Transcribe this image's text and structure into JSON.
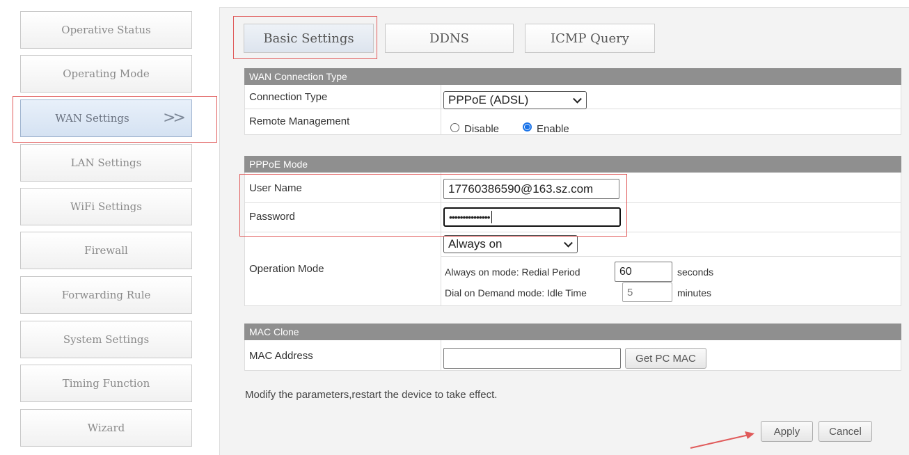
{
  "sidebar": {
    "items": [
      {
        "label": "Operative Status"
      },
      {
        "label": "Operating Mode"
      },
      {
        "label": "WAN Settings",
        "arrows": ">>"
      },
      {
        "label": "LAN Settings"
      },
      {
        "label": "WiFi Settings"
      },
      {
        "label": "Firewall"
      },
      {
        "label": "Forwarding Rule"
      },
      {
        "label": "System Settings"
      },
      {
        "label": "Timing Function"
      },
      {
        "label": "Wizard"
      }
    ],
    "active_index": 2
  },
  "tabs": [
    {
      "label": "Basic Settings"
    },
    {
      "label": "DDNS"
    },
    {
      "label": "ICMP Query"
    }
  ],
  "wan_type": {
    "title": "WAN Connection Type",
    "connection_type_label": "Connection Type",
    "connection_type_value": "PPPoE (ADSL)",
    "remote_mgmt_label": "Remote Management",
    "disable_label": "Disable",
    "enable_label": "Enable",
    "remote_mgmt_selected": "Enable"
  },
  "pppoe": {
    "title": "PPPoE Mode",
    "username_label": "User Name",
    "username_value": "17760386590@163.sz.com",
    "password_label": "Password",
    "password_value": "•••••••••••••••",
    "operation_mode_label": "Operation Mode",
    "operation_mode_value": "Always on",
    "redial_label": "Always on mode: Redial Period",
    "redial_value": "60",
    "redial_unit": "seconds",
    "idle_label": "Dial on Demand mode: Idle Time",
    "idle_value": "5",
    "idle_unit": "minutes"
  },
  "mac": {
    "title": "MAC Clone",
    "address_label": "MAC Address",
    "address_value": "",
    "get_pc_mac_label": "Get PC MAC"
  },
  "footer": {
    "note": "Modify the parameters,restart the device to take effect.",
    "apply_label": "Apply",
    "cancel_label": "Cancel"
  },
  "colors": {
    "annotation": "#e05a5a",
    "radio_selected": "#1a73e8",
    "section_header": "#8f8f8f"
  }
}
